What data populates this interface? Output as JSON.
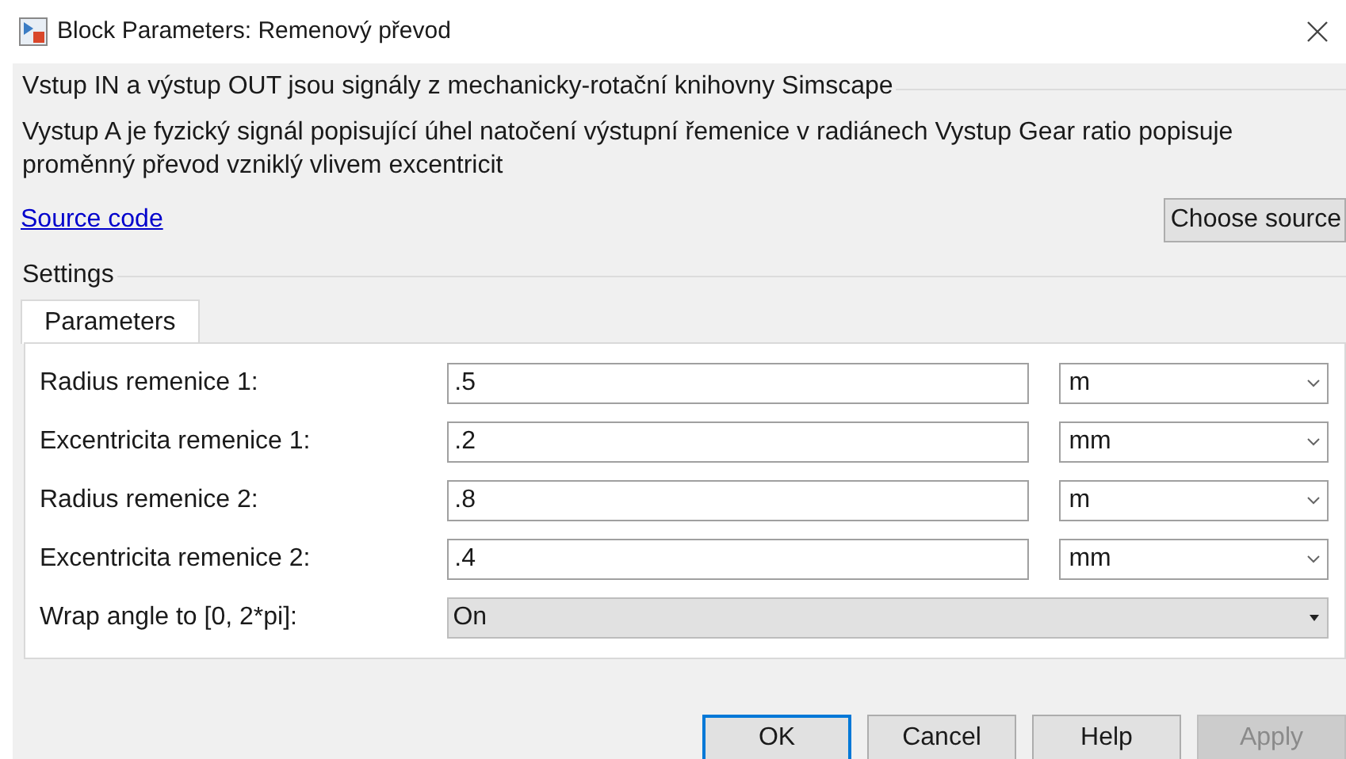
{
  "window": {
    "title": "Block Parameters: Remenový převod"
  },
  "description": {
    "title": "Vstup IN a výstup OUT jsou signály z mechanicky-rotační knihovny Simscape",
    "text": "Vystup A je fyzický signál popisující úhel natočení výstupní řemenice v radiánech Vystup Gear ratio popisuje proměnný převod vzniklý vlivem excentricit",
    "link": "Source code",
    "button": "Choose source"
  },
  "settings": {
    "title": "Settings",
    "tabs": [
      {
        "label": "Parameters",
        "selected": true
      }
    ],
    "parameters": [
      {
        "kind": "value",
        "label": "Radius remenice 1:",
        "value": ".5",
        "unit": "m"
      },
      {
        "kind": "value",
        "label": "Excentricita remenice 1:",
        "value": ".2",
        "unit": "mm"
      },
      {
        "kind": "value",
        "label": "Radius remenice 2:",
        "value": ".8",
        "unit": "m"
      },
      {
        "kind": "value",
        "label": "Excentricita remenice 2:",
        "value": ".4",
        "unit": "mm"
      },
      {
        "kind": "choice",
        "label": "Wrap angle to [0, 2*pi]:",
        "value": "On"
      }
    ]
  },
  "buttons": [
    {
      "label": "OK",
      "default": true,
      "disabled": false
    },
    {
      "label": "Cancel",
      "default": false,
      "disabled": false
    },
    {
      "label": "Help",
      "default": false,
      "disabled": false
    },
    {
      "label": "Apply",
      "default": false,
      "disabled": true
    }
  ]
}
